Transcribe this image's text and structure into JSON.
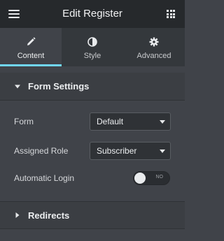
{
  "header": {
    "title": "Edit Register",
    "menu_icon": "hamburger-menu-icon",
    "apps_icon": "grid-apps-icon"
  },
  "tabs": [
    {
      "label": "Content",
      "icon": "pencil-icon",
      "active": true
    },
    {
      "label": "Style",
      "icon": "half-circle-contrast-icon",
      "active": false
    },
    {
      "label": "Advanced",
      "icon": "gear-icon",
      "active": false
    }
  ],
  "form_settings": {
    "title": "Form Settings",
    "expanded": true,
    "fields": {
      "form": {
        "label": "Form",
        "value": "Default"
      },
      "role": {
        "label": "Assigned Role",
        "value": "Subscriber"
      },
      "auto_login": {
        "label": "Automatic Login",
        "toggle_text": "NO",
        "on": false
      }
    }
  },
  "redirects": {
    "title": "Redirects",
    "expanded": false
  },
  "colors": {
    "accent": "#71d7f7",
    "header_bg": "#26292c",
    "panel_bg": "#404349"
  }
}
